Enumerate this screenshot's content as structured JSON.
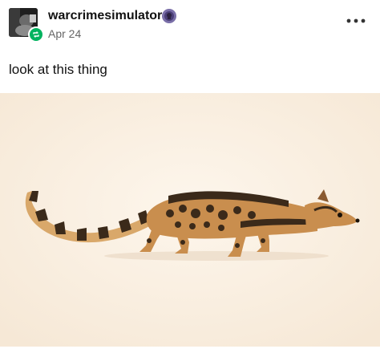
{
  "post": {
    "username": "warcrimesimulator",
    "date": "Apr 24",
    "caption": "look at this thing",
    "avatar_icon": "user-avatar",
    "reblog_icon": "reblog-icon",
    "badge_icon": "user-badge-icon",
    "more_icon": "more-options-icon",
    "image_subject": "genet-like animal photo"
  },
  "colors": {
    "reblog_badge": "#00b35f",
    "date_text": "#666666",
    "photo_background": "#fbf1e3"
  }
}
